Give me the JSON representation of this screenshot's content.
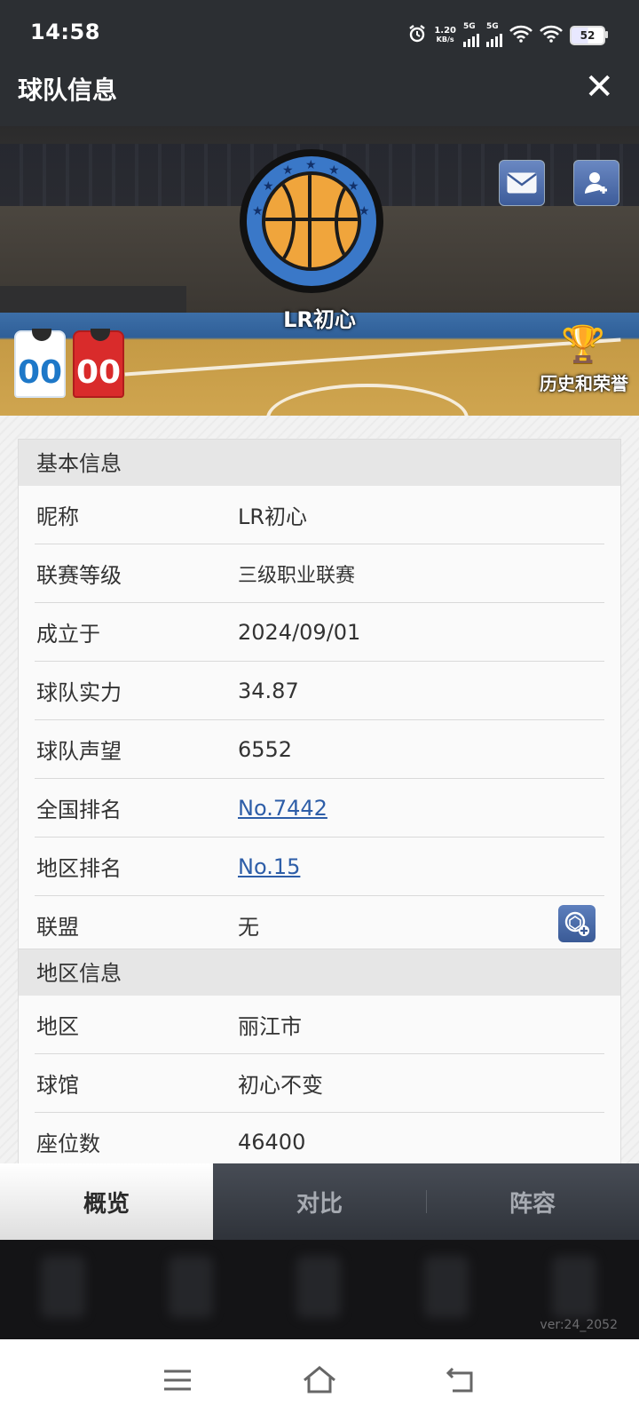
{
  "status_bar": {
    "time": "14:58",
    "net_speed_value": "1.20",
    "net_speed_unit": "KB/s",
    "signal1": "5G",
    "signal2": "5G",
    "battery": "52"
  },
  "header": {
    "title": "球队信息"
  },
  "banner": {
    "team_name": "LR初心",
    "home_jersey_number": "00",
    "away_jersey_number": "00",
    "history_label": "历史和荣誉"
  },
  "basic_info": {
    "section_title": "基本信息",
    "rows": [
      {
        "label": "昵称",
        "value": "LR初心"
      },
      {
        "label": "联赛等级",
        "value": "三级职业联赛"
      },
      {
        "label": "成立于",
        "value": "2024/09/01"
      },
      {
        "label": "球队实力",
        "value": "34.87"
      },
      {
        "label": "球队声望",
        "value": "6552"
      },
      {
        "label": "全国排名",
        "value": "No.7442"
      },
      {
        "label": "地区排名",
        "value": "No.15"
      },
      {
        "label": "联盟",
        "value": "无"
      }
    ]
  },
  "region_info": {
    "section_title": "地区信息",
    "rows": [
      {
        "label": "地区",
        "value": "丽江市"
      },
      {
        "label": "球馆",
        "value": "初心不变"
      },
      {
        "label": "座位数",
        "value": "46400"
      }
    ]
  },
  "tabs": [
    {
      "label": "概览",
      "active": true
    },
    {
      "label": "对比",
      "active": false
    },
    {
      "label": "阵容",
      "active": false
    }
  ],
  "version": "ver:24_2052",
  "colors": {
    "accent_blue": "#3a78c8",
    "link": "#2e5ea8",
    "topbar": "#2c2f33"
  }
}
